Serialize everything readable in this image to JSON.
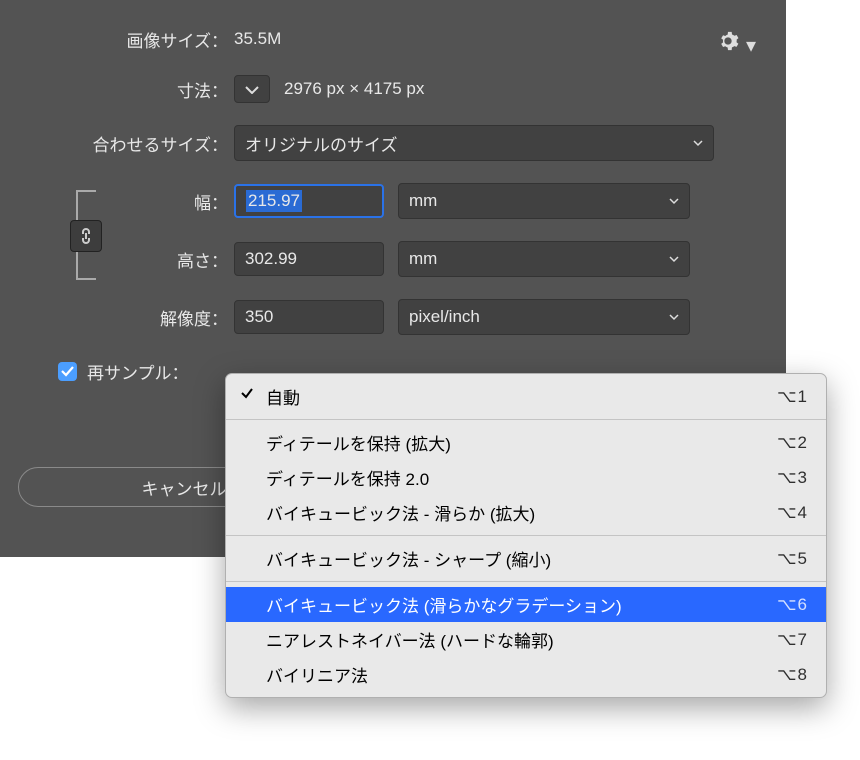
{
  "labels": {
    "imageSize": "画像サイズ：",
    "dimensions": "寸法：",
    "fitTo": "合わせるサイズ：",
    "width": "幅：",
    "height": "高さ：",
    "resolution": "解像度：",
    "resample": "再サンプル："
  },
  "imageSizeValue": "35.5M",
  "dimensionsValue": "2976 px × 4175 px",
  "fitToValue": "オリジナルのサイズ",
  "widthValue": "215.97",
  "widthUnit": "mm",
  "heightValue": "302.99",
  "heightUnit": "mm",
  "resolutionValue": "350",
  "resolutionUnit": "pixel/inch",
  "cancel": "キャンセル",
  "menu": {
    "items": [
      {
        "label": "自動",
        "shortcut": "⌥1",
        "checked": true
      },
      {
        "sep": true
      },
      {
        "label": "ディテールを保持 (拡大)",
        "shortcut": "⌥2"
      },
      {
        "label": "ディテールを保持 2.0",
        "shortcut": "⌥3"
      },
      {
        "label": "バイキュービック法 - 滑らか (拡大)",
        "shortcut": "⌥4"
      },
      {
        "sep": true
      },
      {
        "label": "バイキュービック法 - シャープ (縮小)",
        "shortcut": "⌥5"
      },
      {
        "sep": true
      },
      {
        "label": "バイキュービック法 (滑らかなグラデーション)",
        "shortcut": "⌥6",
        "selected": true
      },
      {
        "label": "ニアレストネイバー法 (ハードな輪郭)",
        "shortcut": "⌥7"
      },
      {
        "label": "バイリニア法",
        "shortcut": "⌥8"
      }
    ]
  }
}
